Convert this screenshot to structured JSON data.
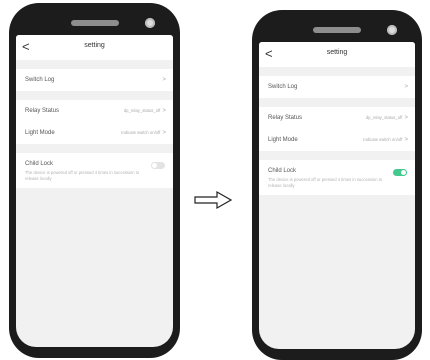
{
  "screens": [
    {
      "title": "setting",
      "back_label": "<",
      "rows": {
        "switch_log": {
          "label": "Switch Log",
          "chevron": ">"
        },
        "relay_status": {
          "label": "Relay Status",
          "value": "dp_relay_status_off",
          "chevron": ">"
        },
        "light_mode": {
          "label": "Light Mode",
          "value": "Indicate switch on/off",
          "chevron": ">"
        },
        "child_lock": {
          "label": "Child Lock",
          "description": "The device is powered off or pressed 4 times in succession to release locally",
          "enabled": false
        }
      }
    },
    {
      "title": "setting",
      "back_label": "<",
      "rows": {
        "switch_log": {
          "label": "Switch Log",
          "chevron": ">"
        },
        "relay_status": {
          "label": "Relay Status",
          "value": "dp_relay_status_off",
          "chevron": ">"
        },
        "light_mode": {
          "label": "Light Mode",
          "value": "Indicate switch on/off",
          "chevron": ">"
        },
        "child_lock": {
          "label": "Child Lock",
          "description": "The device is powered off or pressed 4 times in succession to release locally",
          "enabled": true
        }
      }
    }
  ],
  "colors": {
    "toggle_on": "#43c98d",
    "toggle_off": "#e3e3e3",
    "phone_frame": "#1c1c1c"
  }
}
